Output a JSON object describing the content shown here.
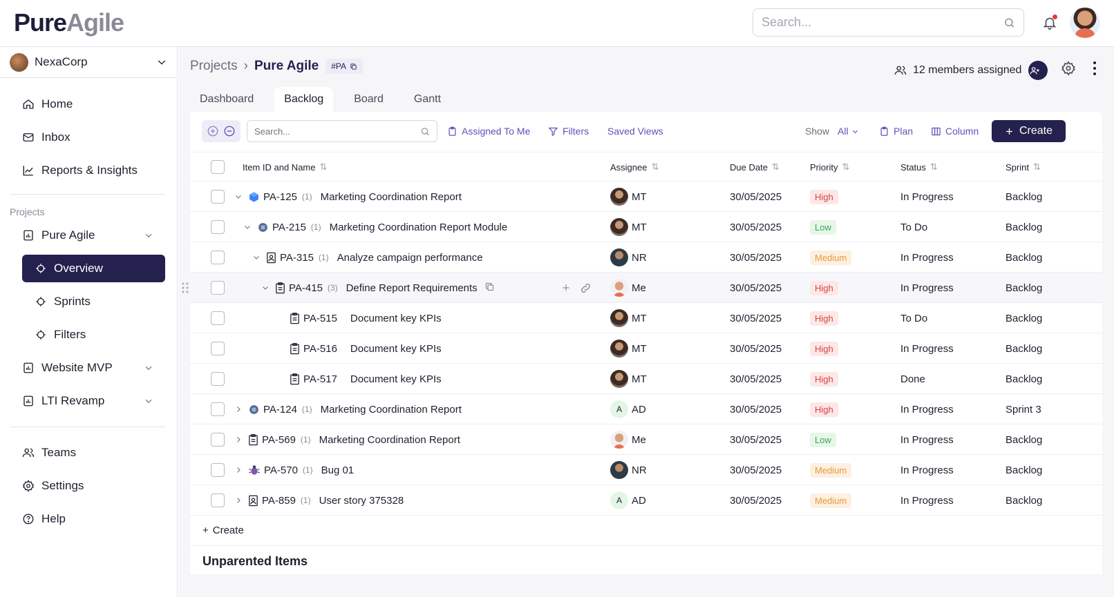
{
  "app": {
    "logo_part1": "Pure",
    "logo_part2": "Agile"
  },
  "top_search": {
    "placeholder": "Search..."
  },
  "sidebar": {
    "org_name": "NexaCorp",
    "nav": [
      {
        "label": "Home",
        "icon": "home-icon"
      },
      {
        "label": "Inbox",
        "icon": "mail-icon"
      },
      {
        "label": "Reports & Insights",
        "icon": "chart-icon"
      }
    ],
    "projects_label": "Projects",
    "projects": [
      {
        "label": "Pure Agile"
      },
      {
        "label": "Website MVP"
      },
      {
        "label": "LTI Revamp"
      }
    ],
    "project_subitems": [
      {
        "label": "Overview",
        "active": true
      },
      {
        "label": "Sprints",
        "active": false
      },
      {
        "label": "Filters",
        "active": false
      }
    ],
    "bottom": [
      {
        "label": "Teams",
        "icon": "users-icon"
      },
      {
        "label": "Settings",
        "icon": "gear-icon"
      },
      {
        "label": "Help",
        "icon": "help-icon"
      }
    ]
  },
  "breadcrumb": {
    "parent": "Projects",
    "current": "Pure Agile",
    "key": "#PA"
  },
  "members": {
    "label": "12 members assigned"
  },
  "tabs": [
    {
      "label": "Dashboard",
      "active": false
    },
    {
      "label": "Backlog",
      "active": true
    },
    {
      "label": "Board",
      "active": false
    },
    {
      "label": "Gantt",
      "active": false
    }
  ],
  "toolbar": {
    "search_placeholder": "Search...",
    "assigned_to_me": "Assigned To Me",
    "filters": "Filters",
    "saved_views": "Saved Views",
    "show_label": "Show",
    "show_value": "All",
    "plan": "Plan",
    "column": "Column",
    "create": "Create"
  },
  "columns": {
    "item": "Item ID and Name",
    "assignee": "Assignee",
    "due_date": "Due Date",
    "priority": "Priority",
    "status": "Status",
    "sprint": "Sprint"
  },
  "rows": [
    {
      "id": "PA-125",
      "count": "(1)",
      "name": "Marketing Coordination Report",
      "assignee": "MT",
      "due": "30/05/2025",
      "priority": "High",
      "status": "In Progress",
      "sprint": "Backlog",
      "type": "epic-icon",
      "chevron": "down"
    },
    {
      "id": "PA-215",
      "count": "(1)",
      "name": "Marketing Coordination Report Module",
      "assignee": "MT",
      "due": "30/05/2025",
      "priority": "Low",
      "status": "To Do",
      "sprint": "Backlog",
      "type": "feature-icon",
      "chevron": "down"
    },
    {
      "id": "PA-315",
      "count": "(1)",
      "name": "Analyze campaign performance",
      "assignee": "NR",
      "due": "30/05/2025",
      "priority": "Medium",
      "status": "In Progress",
      "sprint": "Backlog",
      "type": "story-icon",
      "chevron": "down"
    },
    {
      "id": "PA-415",
      "count": "(3)",
      "name": "Define Report Requirements",
      "assignee": "Me",
      "due": "30/05/2025",
      "priority": "High",
      "status": "In Progress",
      "sprint": "Backlog",
      "type": "task-icon",
      "chevron": "down"
    },
    {
      "id": "PA-515",
      "count": "",
      "name": "Document key KPIs",
      "assignee": "MT",
      "due": "30/05/2025",
      "priority": "High",
      "status": "To Do",
      "sprint": "Backlog",
      "type": "subtask-icon",
      "chevron": ""
    },
    {
      "id": "PA-516",
      "count": "",
      "name": "Document key KPIs",
      "assignee": "MT",
      "due": "30/05/2025",
      "priority": "High",
      "status": "In Progress",
      "sprint": "Backlog",
      "type": "subtask-icon",
      "chevron": ""
    },
    {
      "id": "PA-517",
      "count": "",
      "name": "Document key KPIs",
      "assignee": "MT",
      "due": "30/05/2025",
      "priority": "High",
      "status": "Done",
      "sprint": "Backlog",
      "type": "subtask-icon",
      "chevron": ""
    },
    {
      "id": "PA-124",
      "count": "(1)",
      "name": "Marketing Coordination Report",
      "assignee": "AD",
      "due": "30/05/2025",
      "priority": "High",
      "status": "In Progress",
      "sprint": "Sprint 3",
      "type": "feature-icon",
      "chevron": "right"
    },
    {
      "id": "PA-569",
      "count": "(1)",
      "name": "Marketing Coordination Report",
      "assignee": "Me",
      "due": "30/05/2025",
      "priority": "Low",
      "status": "In Progress",
      "sprint": "Backlog",
      "type": "task-icon",
      "chevron": "right"
    },
    {
      "id": "PA-570",
      "count": "(1)",
      "name": "Bug 01",
      "assignee": "NR",
      "due": "30/05/2025",
      "priority": "Medium",
      "status": "In Progress",
      "sprint": "Backlog",
      "type": "bug-icon",
      "chevron": "right"
    },
    {
      "id": "PA-859",
      "count": "(1)",
      "name": "User story 375328",
      "assignee": "AD",
      "due": "30/05/2025",
      "priority": "Medium",
      "status": "In Progress",
      "sprint": "Backlog",
      "type": "story-icon",
      "chevron": "right"
    }
  ],
  "create_row": {
    "label": "Create"
  },
  "unparented": {
    "title": "Unparented Items"
  },
  "assignee_initials": {
    "A": "A"
  }
}
